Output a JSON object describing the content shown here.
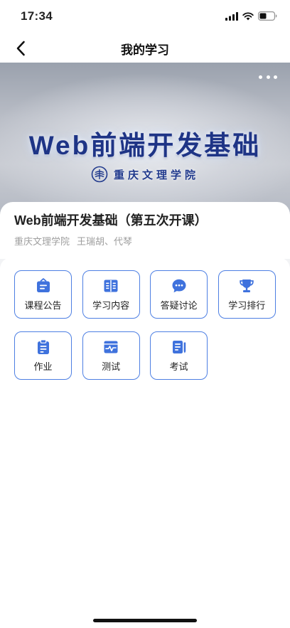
{
  "status_bar": {
    "time": "17:34",
    "icons": [
      "signal-icon",
      "wifi-icon",
      "battery-icon"
    ]
  },
  "nav": {
    "title": "我的学习",
    "back_icon": "chevron-left-icon"
  },
  "banner": {
    "title": "Web前端开发基础",
    "school": "重庆文理学院",
    "more_icon": "more-dots-icon",
    "logo_icon": "school-logo-icon"
  },
  "course": {
    "name": "Web前端开发基础（第五次开课）",
    "school": "重庆文理学院",
    "teachers": "王瑞胡、代琴"
  },
  "features": [
    {
      "label": "课程公告",
      "icon": "announcement-icon"
    },
    {
      "label": "学习内容",
      "icon": "book-icon"
    },
    {
      "label": "答疑讨论",
      "icon": "chat-icon"
    },
    {
      "label": "学习排行",
      "icon": "trophy-icon"
    },
    {
      "label": "作业",
      "icon": "clipboard-icon"
    },
    {
      "label": "测试",
      "icon": "monitor-pulse-icon"
    },
    {
      "label": "考试",
      "icon": "exam-icon"
    }
  ],
  "colors": {
    "accent": "#3f72dd",
    "button_border": "#4d7fe3",
    "text": "#222222",
    "muted": "#9e9e9e",
    "banner_title": "#1e3486"
  }
}
